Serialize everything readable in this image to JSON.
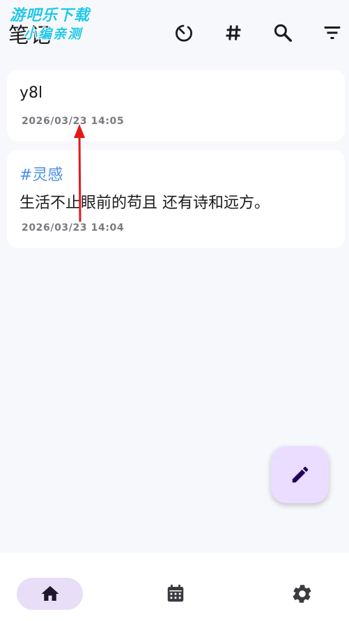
{
  "header": {
    "title": "笔记",
    "watermark_line1": "游吧乐下载",
    "watermark_line2": "小编亲测",
    "actions": [
      "timer-icon",
      "hashtag-icon",
      "search-icon",
      "filter-icon"
    ]
  },
  "notes": [
    {
      "title": "y8l",
      "date": "2026/03/23 14:05"
    },
    {
      "tag": "#灵感",
      "body": "生活不止眼前的苟且 还有诗和远方。",
      "date": "2026/03/23 14:04"
    }
  ],
  "fab": {
    "icon": "edit-icon"
  },
  "bottom_nav": {
    "items": [
      {
        "icon": "home-icon",
        "selected": true
      },
      {
        "icon": "calendar-icon",
        "selected": false
      },
      {
        "icon": "settings-icon",
        "selected": false
      }
    ]
  },
  "colors": {
    "background": "#f7f8fb",
    "tag": "#4a8ee6",
    "fab": "#eaddff",
    "nav_active": "#e8def8",
    "annotation_arrow": "#e31919"
  }
}
